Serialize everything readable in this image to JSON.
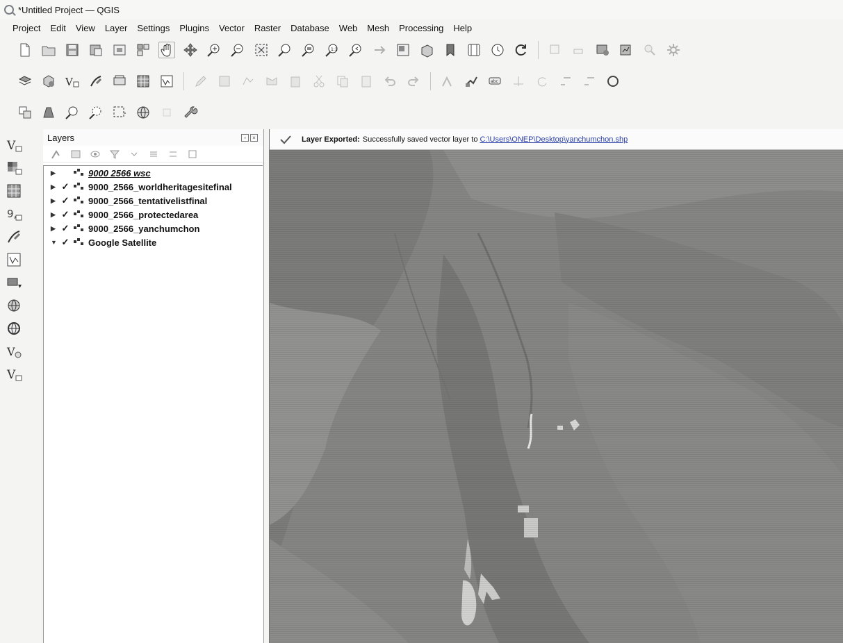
{
  "window": {
    "title": "*Untitled Project — QGIS"
  },
  "menubar": {
    "items": [
      "Project",
      "Edit",
      "View",
      "Layer",
      "Settings",
      "Plugins",
      "Vector",
      "Raster",
      "Database",
      "Web",
      "Mesh",
      "Processing",
      "Help"
    ]
  },
  "layers_panel": {
    "title": "Layers",
    "layers": [
      {
        "name": "9000 2566 wsc",
        "checked": false,
        "style": "italic-underline"
      },
      {
        "name": "9000_2566_worldheritagesitefinal",
        "checked": true
      },
      {
        "name": "9000_2566_tentativelistfinal",
        "checked": true
      },
      {
        "name": "9000_2566_protectedarea",
        "checked": true
      },
      {
        "name": "9000_2566_yanchumchon",
        "checked": true
      },
      {
        "name": "Google Satellite",
        "checked": true,
        "expanded": true
      }
    ]
  },
  "message_bar": {
    "label": "Layer Exported:",
    "text": "Successfully saved vector layer to",
    "path": "C:\\Users\\ONEP\\Desktop\\yanchumchon.shp"
  },
  "icons": {
    "toolbar_row1": [
      "new-project-icon",
      "open-project-icon",
      "save-project-icon",
      "save-as-icon",
      "print-layout-icon",
      "layout-manager-icon",
      "pan-hand-icon",
      "pan-to-selection-icon",
      "zoom-in-icon",
      "zoom-out-icon",
      "zoom-full-icon",
      "zoom-to-selection-icon",
      "zoom-to-layer-icon",
      "zoom-native-icon",
      "zoom-last-icon",
      "zoom-next-icon",
      "new-map-view-icon",
      "new-3d-view-icon",
      "bookmark-icon",
      "temporal-controller-icon",
      "refresh-icon",
      "identify-icon",
      "select-features-icon",
      "open-attribute-table-icon",
      "statistics-icon",
      "measure-icon",
      "settings-icon"
    ],
    "toolbar_row2": [
      "data-source-manager-icon",
      "new-geopackage-icon",
      "add-vector-layer-icon",
      "digitize-icon",
      "add-raster-icon",
      "add-mesh-icon",
      "add-virtual-layer-icon",
      "edit-pencil-icon",
      "save-edits-icon",
      "add-feature-icon",
      "vertex-tool-icon",
      "delete-icon",
      "cut-icon",
      "copy-icon",
      "paste-icon",
      "undo-icon",
      "redo-icon",
      "label-toolbar-icon",
      "pin-label-icon",
      "show-label-icon",
      "move-label-icon",
      "rotate-label-icon",
      "change-label-icon",
      "diagram-icon",
      "help-icon"
    ],
    "toolbar_row3": [
      "python-console-icon",
      "plugin-icon",
      "zoom-search-icon",
      "zoom-select-icon",
      "extent-icon",
      "globe-icon",
      "wrench-icon"
    ]
  }
}
